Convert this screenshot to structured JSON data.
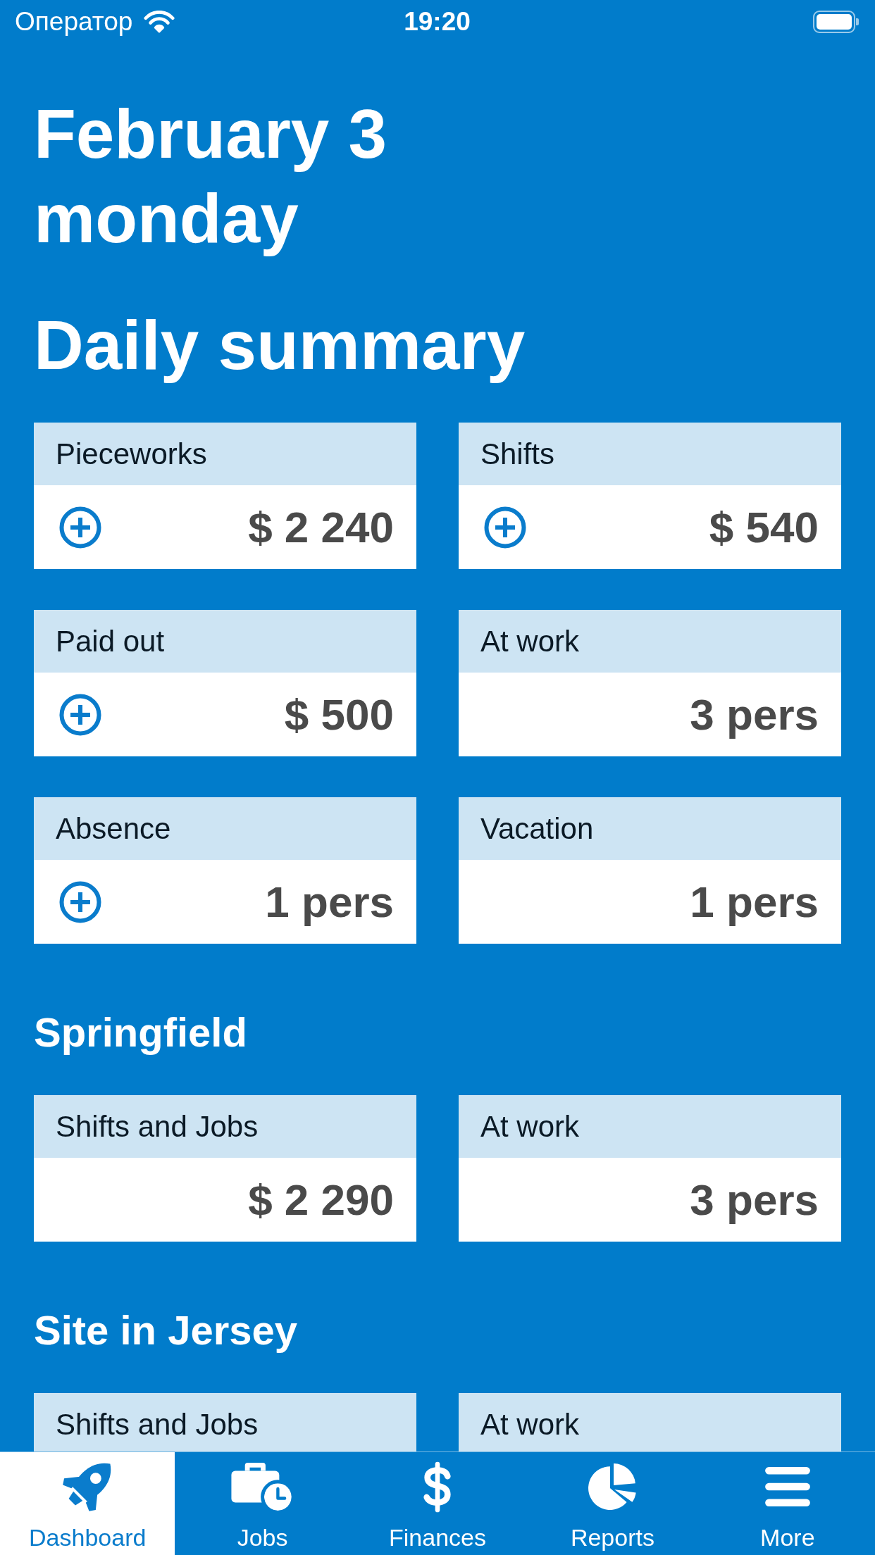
{
  "status_bar": {
    "carrier": "Оператор",
    "time": "19:20"
  },
  "header": {
    "date": "February 3",
    "weekday": "monday"
  },
  "summary": {
    "title": "Daily summary",
    "cards": [
      {
        "label": "Pieceworks",
        "value": "$ 2 240",
        "add": true
      },
      {
        "label": "Shifts",
        "value": "$ 540",
        "add": true
      },
      {
        "label": "Paid out",
        "value": "$ 500",
        "add": true
      },
      {
        "label": "At work",
        "value": "3 pers",
        "add": false
      },
      {
        "label": "Absence",
        "value": "1 pers",
        "add": true
      },
      {
        "label": "Vacation",
        "value": "1 pers",
        "add": false
      }
    ]
  },
  "sites": [
    {
      "name": "Springfield",
      "cards": [
        {
          "label": "Shifts and Jobs",
          "value": "$ 2 290",
          "add": false
        },
        {
          "label": "At work",
          "value": "3 pers",
          "add": false
        }
      ]
    },
    {
      "name": "Site in Jersey",
      "cards": [
        {
          "label": "Shifts and Jobs"
        },
        {
          "label": "At work"
        }
      ]
    }
  ],
  "tab_bar": [
    {
      "label": "Dashboard",
      "kind": "rocket",
      "selected": true
    },
    {
      "label": "Jobs",
      "kind": "briefcase",
      "selected": false
    },
    {
      "label": "Finances",
      "kind": "dollar",
      "selected": false
    },
    {
      "label": "Reports",
      "kind": "pie",
      "selected": false
    },
    {
      "label": "More",
      "kind": "menu",
      "selected": false
    }
  ]
}
